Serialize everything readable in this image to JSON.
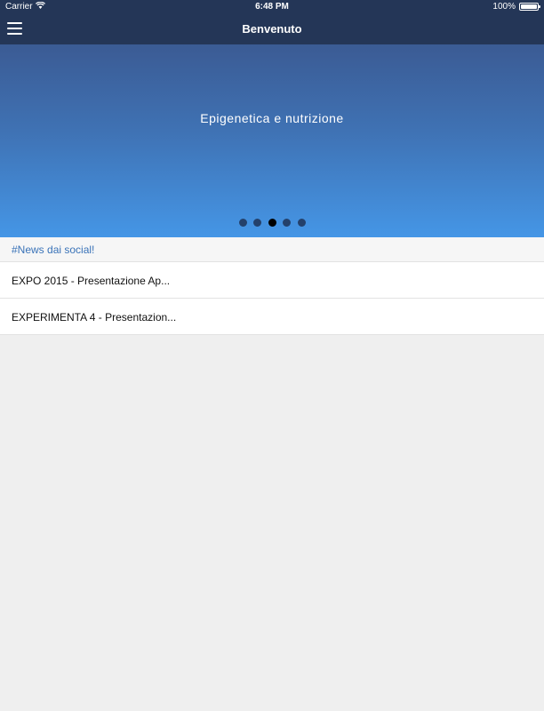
{
  "status_bar": {
    "carrier": "Carrier",
    "time": "6:48 PM",
    "battery": "100%",
    "battery_level": 1.0,
    "wifi_icon": "wifi-icon",
    "battery_icon": "battery-icon"
  },
  "navbar": {
    "title": "Benvenuto",
    "menu_icon": "hamburger-menu-icon"
  },
  "banner": {
    "title": "Epigenetica e nutrizione",
    "page_count": 5,
    "active_page": 3
  },
  "news": {
    "header": "#News dai social!",
    "items": [
      {
        "title": "EXPO 2015 - Presentazione Ap..."
      },
      {
        "title": "EXPERIMENTA 4 - Presentazion..."
      }
    ]
  },
  "colors": {
    "navbar_bg": "#243657",
    "banner_top": "#3b5b94",
    "banner_bottom": "#4596e6",
    "accent_text": "#3a73b8",
    "page_bg": "#efefef"
  }
}
